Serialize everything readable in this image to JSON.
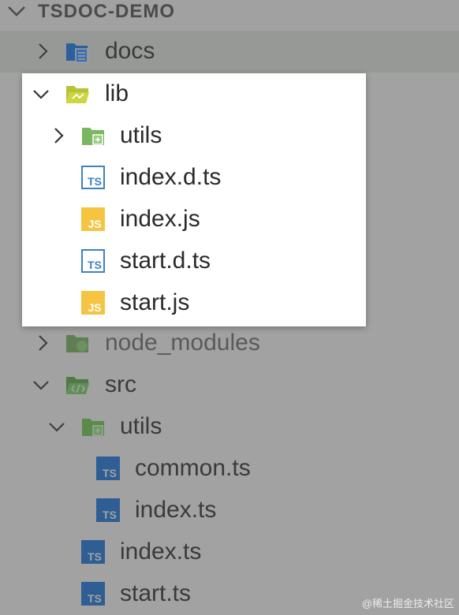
{
  "explorer": {
    "section_title": "TSDOC-DEMO",
    "tree": {
      "docs": {
        "label": "docs",
        "icon": "docs-folder-icon",
        "expanded": false
      },
      "lib": {
        "label": "lib",
        "icon": "lib-folder-open-icon",
        "expanded": true
      },
      "lib_utils": {
        "label": "utils",
        "icon": "utils-folder-icon",
        "expanded": false
      },
      "lib_index_dts": {
        "label": "index.d.ts",
        "icon": "typescript-definition-icon"
      },
      "lib_index_js": {
        "label": "index.js",
        "icon": "javascript-file-icon"
      },
      "lib_start_dts": {
        "label": "start.d.ts",
        "icon": "typescript-definition-icon"
      },
      "lib_start_js": {
        "label": "start.js",
        "icon": "javascript-file-icon"
      },
      "node_modules": {
        "label": "node_modules",
        "icon": "node-modules-folder-icon",
        "expanded": false
      },
      "src": {
        "label": "src",
        "icon": "src-folder-open-icon",
        "expanded": true
      },
      "src_utils": {
        "label": "utils",
        "icon": "utils-folder-open-icon",
        "expanded": true
      },
      "src_utils_common": {
        "label": "common.ts",
        "icon": "typescript-file-icon"
      },
      "src_utils_index": {
        "label": "index.ts",
        "icon": "typescript-file-icon"
      },
      "src_index": {
        "label": "index.ts",
        "icon": "typescript-file-icon"
      },
      "src_start": {
        "label": "start.ts",
        "icon": "typescript-file-icon"
      }
    },
    "icon_text": {
      "ts": "TS",
      "js": "JS"
    }
  },
  "watermark": "@稀土掘金技术社区",
  "colors": {
    "overlay_background": "#a2a2a2",
    "selected_row": "#979997",
    "popup_background": "#ffffff",
    "ts_blue": "#3178c6",
    "js_yellow": "#f5c542",
    "folder_green": "#6aa84f",
    "docs_blue": "#2d5e9e"
  }
}
